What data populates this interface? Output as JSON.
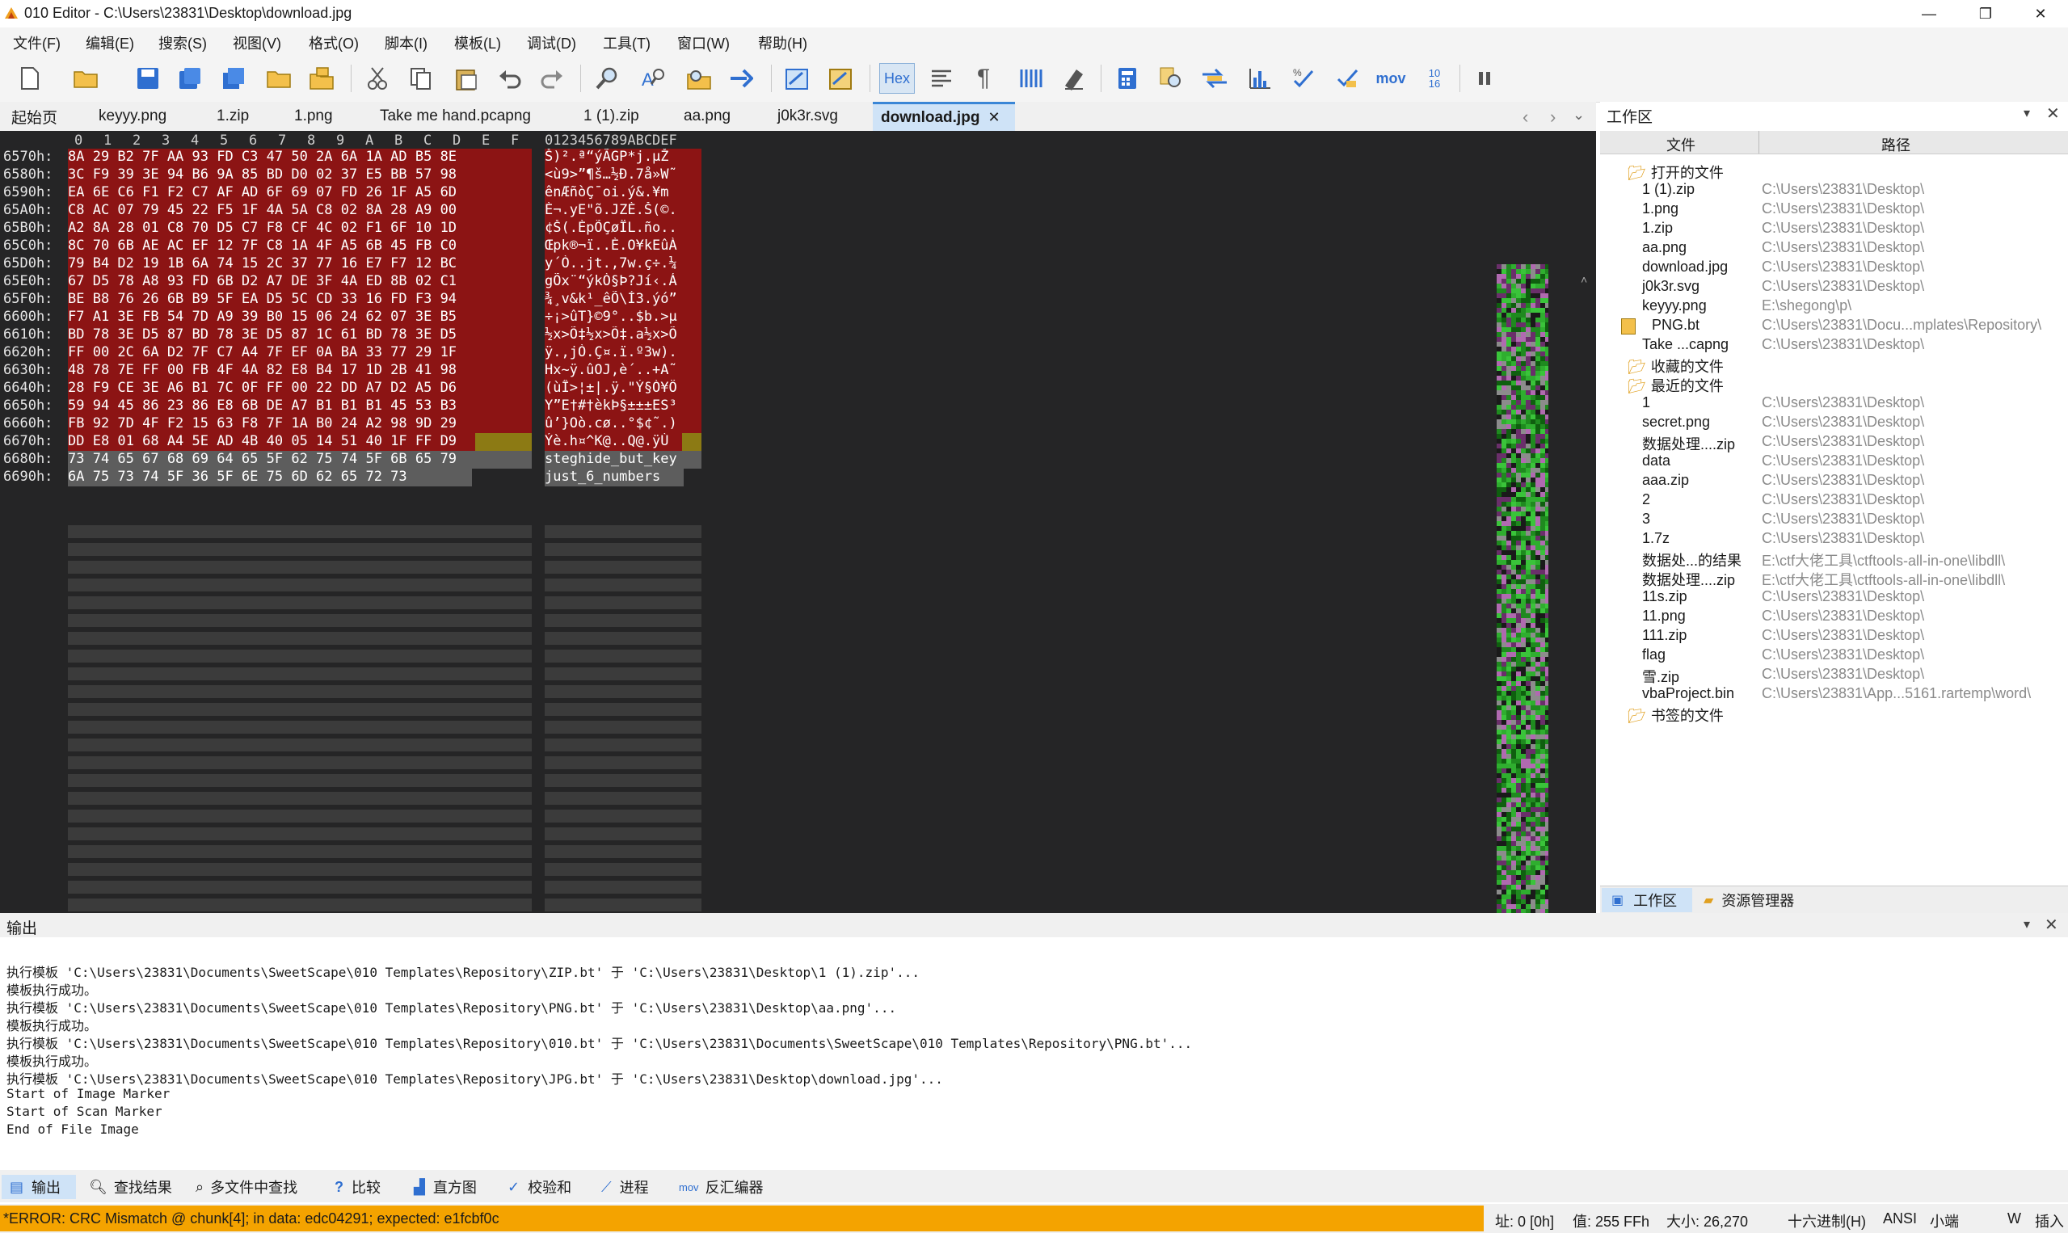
{
  "window": {
    "title": "010 Editor - C:\\Users\\23831\\Desktop\\download.jpg",
    "minimize": "—",
    "maximize": "❐",
    "close": "✕"
  },
  "menu": [
    "文件(F)",
    "编辑(E)",
    "搜索(S)",
    "视图(V)",
    "格式(O)",
    "脚本(I)",
    "模板(L)",
    "调试(D)",
    "工具(T)",
    "窗口(W)",
    "帮助(H)"
  ],
  "toolbar": {
    "hex_label": "Hex",
    "mov_label": "mov",
    "base_label_top": "10",
    "base_label_bottom": "16"
  },
  "tabs": [
    "起始页",
    "keyyy.png",
    "1.zip",
    "1.png",
    "Take me hand.pcapng",
    "1 (1).zip",
    "aa.png",
    "j0k3r.svg",
    "download.jpg"
  ],
  "active_tab_close": "✕",
  "editor": {
    "col_headers": [
      "0",
      "1",
      "2",
      "3",
      "4",
      "5",
      "6",
      "7",
      "8",
      "9",
      "A",
      "B",
      "C",
      "D",
      "E",
      "F"
    ],
    "text_header": "0123456789ABCDEF",
    "rows": [
      {
        "addr": "6570h:",
        "hex": "8A 29 B2 7F AA 93 FD C3 47 50 2A 6A 1A AD B5 8E",
        "text": "Š)².ª“ýÃGP*j.­µŽ"
      },
      {
        "addr": "6580h:",
        "hex": "3C F9 39 3E 94 B6 9A 85 BD D0 02 37 E5 BB 57 98",
        "text": "<ù9>”¶š…½Ð.7å»W˜"
      },
      {
        "addr": "6590h:",
        "hex": "EA 6E C6 F1 F2 C7 AF AD 6F 69 07 FD 26 1F A5 6D",
        "text": "ênÆñòÇ¯­oi.ý&.¥m"
      },
      {
        "addr": "65A0h:",
        "hex": "C8 AC 07 79 45 22 F5 1F 4A 5A C8 02 8A 28 A9 00",
        "text": "È¬.yE\"õ.JZÈ.Š(©."
      },
      {
        "addr": "65B0h:",
        "hex": "A2 8A 28 01 C8 70 D5 C7 F8 CF 4C 02 F1 6F 10 1D",
        "text": "¢Š(.ÈpÕÇøÏL.ño.."
      },
      {
        "addr": "65C0h:",
        "hex": "8C 70 6B AE AC EF 12 7F C8 1A 4F A5 6B 45 FB C0",
        "text": "Œpk®¬ï..È.O¥kEûÀ"
      },
      {
        "addr": "65D0h:",
        "hex": "79 B4 D2 19 1B 6A 74 15 2C 37 77 16 E7 F7 12 BC",
        "text": "y´Ò..jt.,7w.ç÷.¼"
      },
      {
        "addr": "65E0h:",
        "hex": "67 D5 78 A8 93 FD 6B D2 A7 DE 3F 4A ED 8B 02 C1",
        "text": "gÕx¨“ýkÒ§Þ?Jí‹.Á"
      },
      {
        "addr": "65F0h:",
        "hex": "BE B8 76 26 6B B9 5F EA D5 5C CD 33 16 FD F3 94",
        "text": "¾¸v&k¹_êÕ\\Í3.ýó”"
      },
      {
        "addr": "6600h:",
        "hex": "F7 A1 3E FB 54 7D A9 39 B0 15 06 24 62 07 3E B5",
        "text": "÷¡>ûT}©9°..$b.>µ"
      },
      {
        "addr": "6610h:",
        "hex": "BD 78 3E D5 87 BD 78 3E D5 87 1C 61 BD 78 3E D5",
        "text": "½x>Õ‡½x>Õ‡.a½x>Õ"
      },
      {
        "addr": "6620h:",
        "hex": "FF 00 2C 6A D2 7F C7 A4 7F EF 0A BA 33 77 29 1F",
        "text": "ÿ.,jÒ.Ç¤.ï.º3w)."
      },
      {
        "addr": "6630h:",
        "hex": "48 78 7E FF 00 FB 4F 4A 82 E8 B4 17 1D 2B 41 98",
        "text": "Hx~ÿ.ûOJ‚è´..+A˜"
      },
      {
        "addr": "6640h:",
        "hex": "28 F9 CE 3E A6 B1 7C 0F FF 00 22 DD A7 D2 A5 D6",
        "text": "(ùÎ>¦±|.ÿ.\"Ý§Ò¥Ö"
      },
      {
        "addr": "6650h:",
        "hex": "59 94 45 86 23 86 E8 6B DE A7 B1 B1 B1 45 53 B3",
        "text": "Y”E†#†èkÞ§±±±ES³"
      },
      {
        "addr": "6660h:",
        "hex": "FB 92 7D 4F F2 15 63 F8 7F 1A B0 24 A2 98 9D 29",
        "text": "û’}Oò.cø..°$¢˜.)"
      },
      {
        "addr": "6670h:",
        "hex": "DD E8 01 68 A4 5E AD 4B 40 05 14 51 40 1F FF D9",
        "text": "Ýè.h¤^­K@..Q@.ÿÙ"
      },
      {
        "addr": "6680h:",
        "hex": "73 74 65 67 68 69 64 65 5F 62 75 74 5F 6B 65 79",
        "text": "steghide_but_key"
      },
      {
        "addr": "6690h:",
        "hex": "6A 75 73 74 5F 36 5F 6E 75 6D 62 65 72 73",
        "text": "just_6_numbers"
      }
    ]
  },
  "workspace": {
    "title": "工作区",
    "col_file": "文件",
    "col_path": "路径",
    "groups": {
      "open": "打开的文件",
      "favorites": "收藏的文件",
      "recent": "最近的文件",
      "bookmarks": "书签的文件"
    },
    "open_files": [
      {
        "name": "1 (1).zip",
        "path": "C:\\Users\\23831\\Desktop\\"
      },
      {
        "name": "1.png",
        "path": "C:\\Users\\23831\\Desktop\\"
      },
      {
        "name": "1.zip",
        "path": "C:\\Users\\23831\\Desktop\\"
      },
      {
        "name": "aa.png",
        "path": "C:\\Users\\23831\\Desktop\\"
      },
      {
        "name": "download.jpg",
        "path": "C:\\Users\\23831\\Desktop\\"
      },
      {
        "name": "j0k3r.svg",
        "path": "C:\\Users\\23831\\Desktop\\"
      },
      {
        "name": "keyyy.png",
        "path": "E:\\shegong\\p\\"
      },
      {
        "name": "PNG.bt",
        "path": "C:\\Users\\23831\\Docu...mplates\\Repository\\"
      },
      {
        "name": "Take ...capng",
        "path": "C:\\Users\\23831\\Desktop\\"
      }
    ],
    "recent_files": [
      {
        "name": "1",
        "path": "C:\\Users\\23831\\Desktop\\"
      },
      {
        "name": "secret.png",
        "path": "C:\\Users\\23831\\Desktop\\"
      },
      {
        "name": "数据处理....zip",
        "path": "C:\\Users\\23831\\Desktop\\"
      },
      {
        "name": "data",
        "path": "C:\\Users\\23831\\Desktop\\"
      },
      {
        "name": "aaa.zip",
        "path": "C:\\Users\\23831\\Desktop\\"
      },
      {
        "name": "2",
        "path": "C:\\Users\\23831\\Desktop\\"
      },
      {
        "name": "3",
        "path": "C:\\Users\\23831\\Desktop\\"
      },
      {
        "name": "1.7z",
        "path": "C:\\Users\\23831\\Desktop\\"
      },
      {
        "name": "数据处...的结果",
        "path": "E:\\ctf大佬工具\\ctftools-all-in-one\\libdll\\"
      },
      {
        "name": "数据处理....zip",
        "path": "E:\\ctf大佬工具\\ctftools-all-in-one\\libdll\\"
      },
      {
        "name": "11s.zip",
        "path": "C:\\Users\\23831\\Desktop\\"
      },
      {
        "name": "11.png",
        "path": "C:\\Users\\23831\\Desktop\\"
      },
      {
        "name": "111.zip",
        "path": "C:\\Users\\23831\\Desktop\\"
      },
      {
        "name": "flag",
        "path": "C:\\Users\\23831\\Desktop\\"
      },
      {
        "name": "雪.zip",
        "path": "C:\\Users\\23831\\Desktop\\"
      },
      {
        "name": "vbaProject.bin",
        "path": "C:\\Users\\23831\\App...5161.rartemp\\word\\"
      }
    ],
    "bottom_tabs": [
      "工作区",
      "资源管理器"
    ]
  },
  "output": {
    "title": "输出",
    "lines": [
      "执行模板 'C:\\Users\\23831\\Documents\\SweetScape\\010 Templates\\Repository\\ZIP.bt' 于 'C:\\Users\\23831\\Desktop\\1 (1).zip'...",
      "模板执行成功。",
      "执行模板 'C:\\Users\\23831\\Documents\\SweetScape\\010 Templates\\Repository\\PNG.bt' 于 'C:\\Users\\23831\\Desktop\\aa.png'...",
      "模板执行成功。",
      "执行模板 'C:\\Users\\23831\\Documents\\SweetScape\\010 Templates\\Repository\\010.bt' 于 'C:\\Users\\23831\\Documents\\SweetScape\\010 Templates\\Repository\\PNG.bt'...",
      "模板执行成功。",
      "执行模板 'C:\\Users\\23831\\Documents\\SweetScape\\010 Templates\\Repository\\JPG.bt' 于 'C:\\Users\\23831\\Desktop\\download.jpg'...",
      "Start of Image Marker",
      "Start of Scan Marker",
      "End of File Image"
    ]
  },
  "bottom_tabs": [
    "输出",
    "查找结果",
    "多文件中查找",
    "比较",
    "直方图",
    "校验和",
    "进程",
    "反汇编器"
  ],
  "status": {
    "error": "*ERROR: CRC Mismatch @ chunk[4]; in data: edc04291; expected: e1fcbf0c",
    "address": "址: 0 [0h]",
    "value": "值: 255 FFh",
    "size": "大小: 26,270",
    "mode": "十六进制(H)",
    "encoding": "ANSI",
    "endian": "小端",
    "write_mode": "W",
    "insert": "插入"
  },
  "colors": {
    "editor_bg": "#252526",
    "highlight_red": "#8c1414",
    "highlight_gray": "#5d5d5d",
    "highlight_yellow": "#8c8c14",
    "error_bar": "#f4a300",
    "active_tab": "#cfe3f7"
  }
}
